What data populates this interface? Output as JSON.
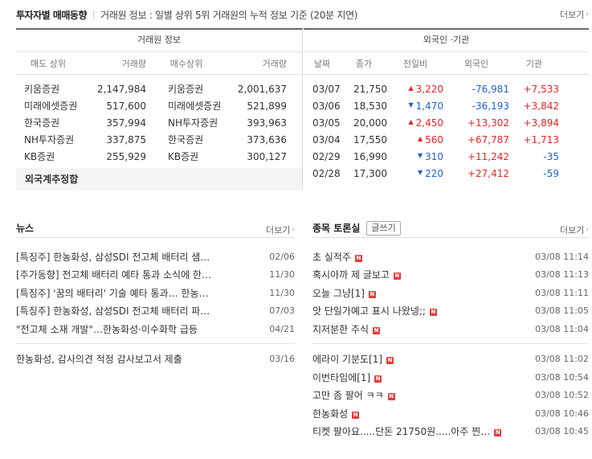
{
  "header": {
    "title": "투자자별 매매동향",
    "subtitle": "거래원 정보 : 일별 상위 5위 거래원의 누적 정보 기준 (20분 지연)",
    "more": "더보기"
  },
  "broker": {
    "title": "거래원 정보",
    "columns": [
      "매도 상위",
      "거래량",
      "매수상위",
      "거래량"
    ],
    "rows": [
      {
        "sell_name": "키움증권",
        "sell_vol": "2,147,984",
        "buy_name": "키움증권",
        "buy_vol": "2,001,637"
      },
      {
        "sell_name": "미래에셋증권",
        "sell_vol": "517,600",
        "buy_name": "미래에셋증권",
        "buy_vol": "521,899"
      },
      {
        "sell_name": "한국증권",
        "sell_vol": "357,994",
        "buy_name": "NH투자증권",
        "buy_vol": "393,963"
      },
      {
        "sell_name": "NH투자증권",
        "sell_vol": "337,875",
        "buy_name": "한국증권",
        "buy_vol": "373,636"
      },
      {
        "sell_name": "KB증권",
        "sell_vol": "255,929",
        "buy_name": "KB증권",
        "buy_vol": "300,127"
      }
    ],
    "foreign_total": "외국계추정합"
  },
  "foreign": {
    "title": "외국인 ·기관",
    "columns": [
      "날짜",
      "종가",
      "전일비",
      "외국인",
      "기관"
    ],
    "rows": [
      {
        "date": "03/07",
        "close": "21,750",
        "dir": "up",
        "change": "3,220",
        "foreign": "-76,981",
        "inst": "+7,533"
      },
      {
        "date": "03/06",
        "close": "18,530",
        "dir": "down",
        "change": "1,470",
        "foreign": "-36,193",
        "inst": "+3,842"
      },
      {
        "date": "03/05",
        "close": "20,000",
        "dir": "up",
        "change": "2,450",
        "foreign": "+13,302",
        "inst": "+3,894"
      },
      {
        "date": "03/04",
        "close": "17,550",
        "dir": "up",
        "change": "560",
        "foreign": "+67,787",
        "inst": "+1,713"
      },
      {
        "date": "02/29",
        "close": "16,990",
        "dir": "down",
        "change": "310",
        "foreign": "+11,242",
        "inst": "-35"
      },
      {
        "date": "02/28",
        "close": "17,300",
        "dir": "down",
        "change": "220",
        "foreign": "+27,412",
        "inst": "-59"
      }
    ],
    "colors": {
      "up": "#e22222",
      "down": "#1e60d6"
    }
  },
  "news": {
    "title": "뉴스",
    "more": "더보기",
    "items": [
      {
        "text": "[특징주] 한농화성, 삼성SDI 전고체 배터리 샘…",
        "date": "02/06"
      },
      {
        "text": "[주가동향] 전고체 배터리 예타 통과 소식에 한…",
        "date": "11/30"
      },
      {
        "text": "[특징주] '꿈의 배터리' 기술 예타 통과… 한농…",
        "date": "11/30"
      },
      {
        "text": "[특징주] 한농화성, 삼성SDI 전고체 배터리 파…",
        "date": "07/03"
      },
      {
        "text": "\"전고체 소재 개발\"…한농화성·이수화학 급등",
        "date": "04/21"
      }
    ],
    "disclosures": [
      {
        "text": "한농화성, 감사의견 적정 감사보고서 제출",
        "date": "03/16"
      }
    ]
  },
  "board": {
    "title": "종목 토론실",
    "write_label": "글쓰기",
    "more": "더보기",
    "new_badge": "N",
    "items": [
      {
        "text": "초 실적주",
        "date": "03/08 11:14"
      },
      {
        "text": "혹시아까 제 글보고",
        "date": "03/08 11:13"
      },
      {
        "text": "오늘 그냥[1]",
        "date": "03/08 11:11"
      },
      {
        "text": "앗 단일가예고 표시 나왔넹;;",
        "date": "03/08 11:05"
      },
      {
        "text": "지저분한 주식",
        "date": "03/08 11:04"
      }
    ],
    "items2": [
      {
        "text": "에라이 기분도[1]",
        "date": "03/08 11:02"
      },
      {
        "text": "이번타임에[1]",
        "date": "03/08 10:54"
      },
      {
        "text": "고만 좀 팔어 ㅋㅋ",
        "date": "03/08 10:52"
      },
      {
        "text": "한농화성",
        "date": "03/08 10:46"
      },
      {
        "text": "티켓 팔아요.....단돈 21750원.....아주 찐…",
        "date": "03/08 10:45"
      }
    ]
  }
}
